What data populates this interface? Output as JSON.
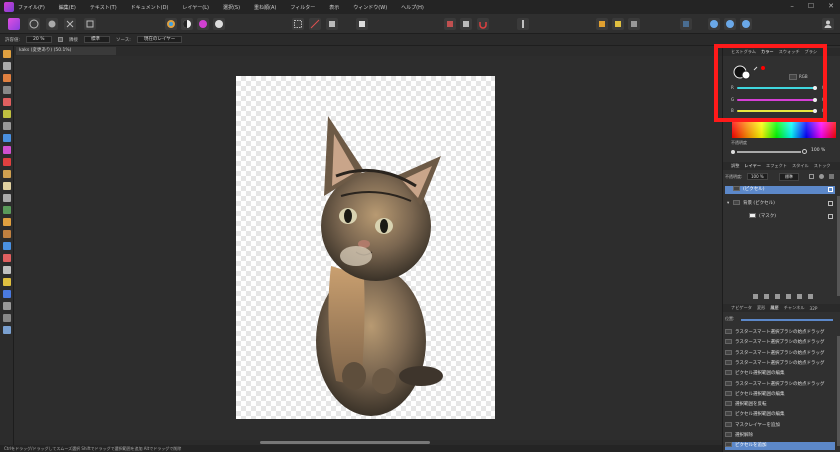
{
  "menu": {
    "items": [
      "ファイル(F)",
      "編集(E)",
      "テキスト(T)",
      "ドキュメント(D)",
      "レイヤー(L)",
      "選択(S)",
      "重ね順(A)",
      "フィルター",
      "表示",
      "ウィンドウ(W)",
      "ヘルプ(H)"
    ],
    "window_controls": [
      "–",
      "☐",
      "✕"
    ]
  },
  "context_bar": {
    "tolerance_label": "許容値:",
    "tolerance_value": "20 %",
    "check_label": "隣接",
    "mode_value": "標準",
    "source_label": "ソース:",
    "source_value": "現在のレイヤー"
  },
  "document": {
    "tab_title": "kaks (変更あり) (50.1%)"
  },
  "status": {
    "text": "Ctrlをドラッグ/ドラッグしてスムーズ選択 Shiftでドラッグで選択範囲を追加 Altでドラッグで削除"
  },
  "color_panel": {
    "tabs": [
      "ヒストグラム",
      "カラー",
      "スウォッチ",
      "ブラシ"
    ],
    "active_tab": "カラー",
    "model_value": "RGB",
    "channels": [
      {
        "label": "R",
        "value": "0",
        "fraction": 1.0
      },
      {
        "label": "G",
        "value": "0",
        "fraction": 1.0
      },
      {
        "label": "B",
        "value": "0",
        "fraction": 1.0
      }
    ],
    "opacity_label": "不透明度",
    "opacity_value": "100 %",
    "colors": {
      "r": "#3fd7de",
      "g": "#d63fd6",
      "b": "#e8e840",
      "highlight": "#ff1a1a",
      "swatch_fill": "#ff0000"
    }
  },
  "layers_panel": {
    "tabs": [
      "調整",
      "レイヤー",
      "エフェクト",
      "スタイル",
      "ストック"
    ],
    "active_tab": "レイヤー",
    "opacity_label": "不透明度:",
    "opacity_value": "100 %",
    "blend_value": "標準",
    "layers": [
      {
        "name": "(ピクセル)",
        "selected": true
      },
      {
        "name": "背景 (ピクセル)",
        "selected": false
      },
      {
        "name": "(マスク)",
        "selected": false
      }
    ]
  },
  "history_panel": {
    "tabs": [
      "ナビゲータ",
      "変形",
      "履歴",
      "チャンネル",
      "32P"
    ],
    "active_tab": "履歴",
    "position_label": "位置:",
    "items": [
      {
        "label": "ラスタースマート選択ブラシの始点ドラッグ",
        "selected": false
      },
      {
        "label": "ラスタースマート選択ブラシの始点ドラッグ",
        "selected": false
      },
      {
        "label": "ラスタースマート選択ブラシの始点ドラッグ",
        "selected": false
      },
      {
        "label": "ラスタースマート選択ブラシの始点ドラッグ",
        "selected": false
      },
      {
        "label": "ピクセル選択範囲の編集",
        "selected": false
      },
      {
        "label": "ラスタースマート選択ブラシの始点ドラッグ",
        "selected": false
      },
      {
        "label": "ピクセル選択範囲の編集",
        "selected": false
      },
      {
        "label": "選択範囲を反転",
        "selected": false
      },
      {
        "label": "ピクセル選択範囲の編集",
        "selected": false
      },
      {
        "label": "マスクレイヤーを追加",
        "selected": false
      },
      {
        "label": "選択解除",
        "selected": false
      },
      {
        "label": "ピクセルを追加",
        "selected": true
      }
    ]
  }
}
